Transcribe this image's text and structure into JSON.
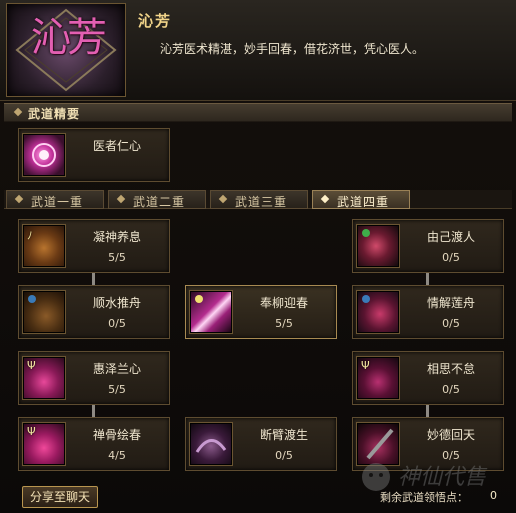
{
  "hero": {
    "emblem_text": "沁芳",
    "name": "沁芳",
    "description": "沁芳医术精湛，妙手回春，借花济世，凭心医人。"
  },
  "section": {
    "title": "武道精要"
  },
  "core_skill": {
    "name": "医者仁心",
    "icon": "pink-flower-swirl-icon"
  },
  "tabs": [
    {
      "label": "武道一重",
      "active": false
    },
    {
      "label": "武道二重",
      "active": false
    },
    {
      "label": "武道三重",
      "active": false
    },
    {
      "label": "武道四重",
      "active": true
    }
  ],
  "skills": {
    "ningshen": {
      "name": "凝神养息",
      "level": "5/5",
      "icon": "leather-pouch-icon"
    },
    "youji": {
      "name": "由己渡人",
      "level": "0/5",
      "icon": "green-swirl-icon"
    },
    "shunshui": {
      "name": "顺水推舟",
      "level": "0/5",
      "icon": "leather-pouch-icon"
    },
    "fengliu": {
      "name": "奉柳迎春",
      "level": "5/5",
      "icon": "pink-light-streak-icon"
    },
    "qingjie": {
      "name": "情解莲舟",
      "level": "0/5",
      "icon": "blue-swirl-icon"
    },
    "huize": {
      "name": "惠泽兰心",
      "level": "5/5",
      "icon": "pink-ribbon-icon"
    },
    "xiangsi": {
      "name": "相思不怠",
      "level": "0/5",
      "icon": "pink-ribbon-icon"
    },
    "chanxiu": {
      "name": "禅骨绘春",
      "level": "4/5",
      "icon": "pink-ribbon-icon"
    },
    "duanbi": {
      "name": "断臂渡生",
      "level": "0/5",
      "icon": "purple-creature-icon"
    },
    "miaode": {
      "name": "妙德回天",
      "level": "0/5",
      "icon": "dark-sword-icon"
    }
  },
  "footer": {
    "share_label": "分享至聊天",
    "remaining_label": "剩余武道领悟点：",
    "remaining_value": "0",
    "watermark": "神仙代售"
  },
  "colors": {
    "accent": "#f2d58a",
    "emblem": "#e35fb2",
    "border": "#5e4c30"
  }
}
